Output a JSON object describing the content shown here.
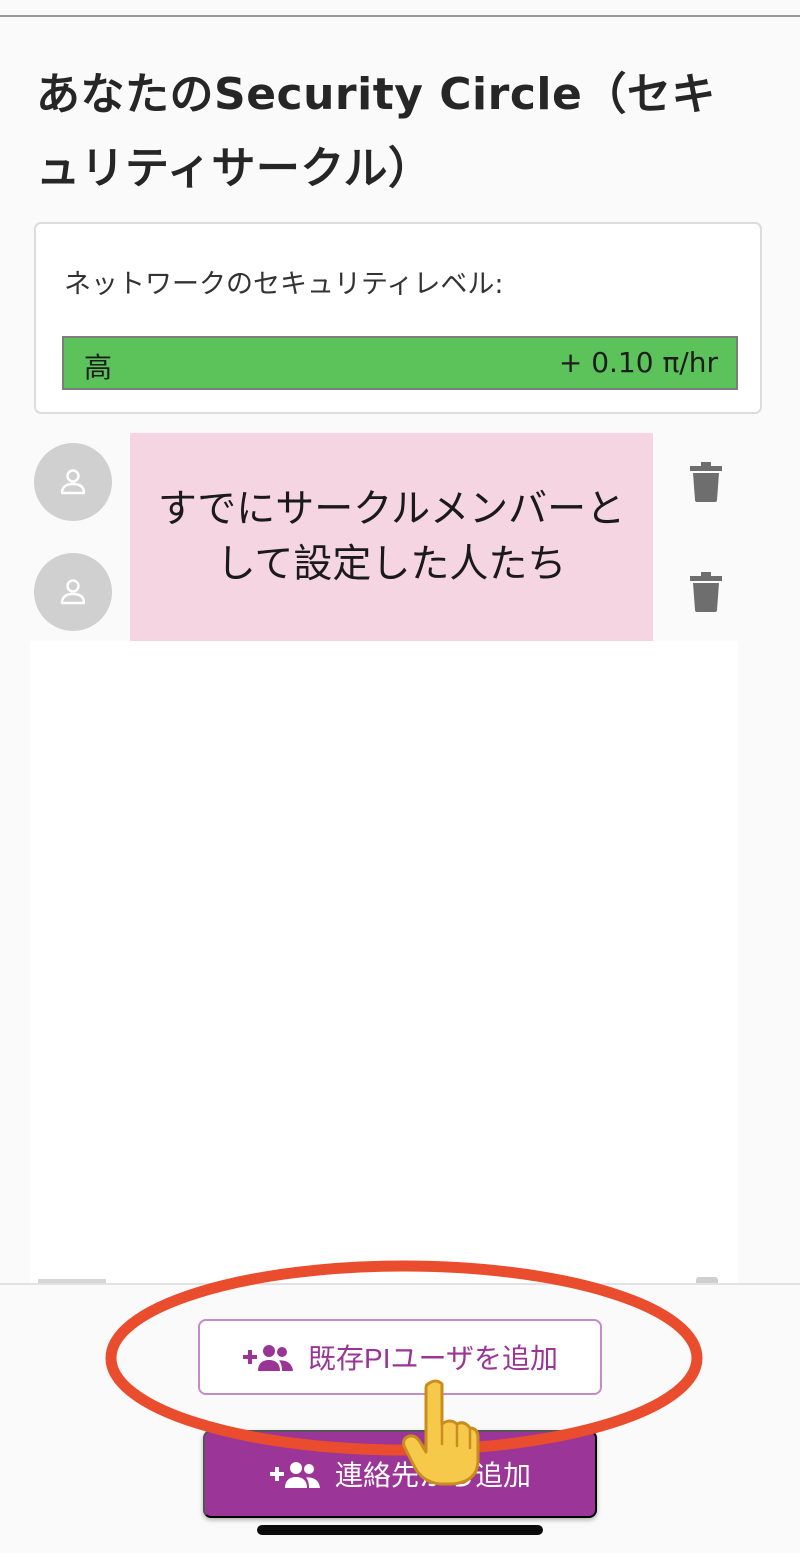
{
  "header": {
    "title": "あなたのSecurity Circle（セキュリティサークル）"
  },
  "security_level": {
    "label": "ネットワークのセキュリティレベル:",
    "level_name": "高",
    "rate": "+ 0.10 π/hr",
    "bar_color": "#5cc25a",
    "fill_fraction": 1.0
  },
  "members": [
    {
      "avatar": "person-icon",
      "action": "trash-icon"
    },
    {
      "avatar": "person-icon",
      "action": "trash-icon"
    }
  ],
  "annotation": {
    "text": "すでにサークルメンバーとして設定した人たち",
    "background": "#f5d5e2"
  },
  "actions": {
    "add_existing_label": "既存PIユーザを追加",
    "add_contacts_label": "連絡先から追加",
    "accent_color": "#9c3598",
    "icon": "add-group-icon"
  },
  "overlay": {
    "highlight_color": "#e94d2d",
    "pointer": "pointing-hand-icon"
  }
}
